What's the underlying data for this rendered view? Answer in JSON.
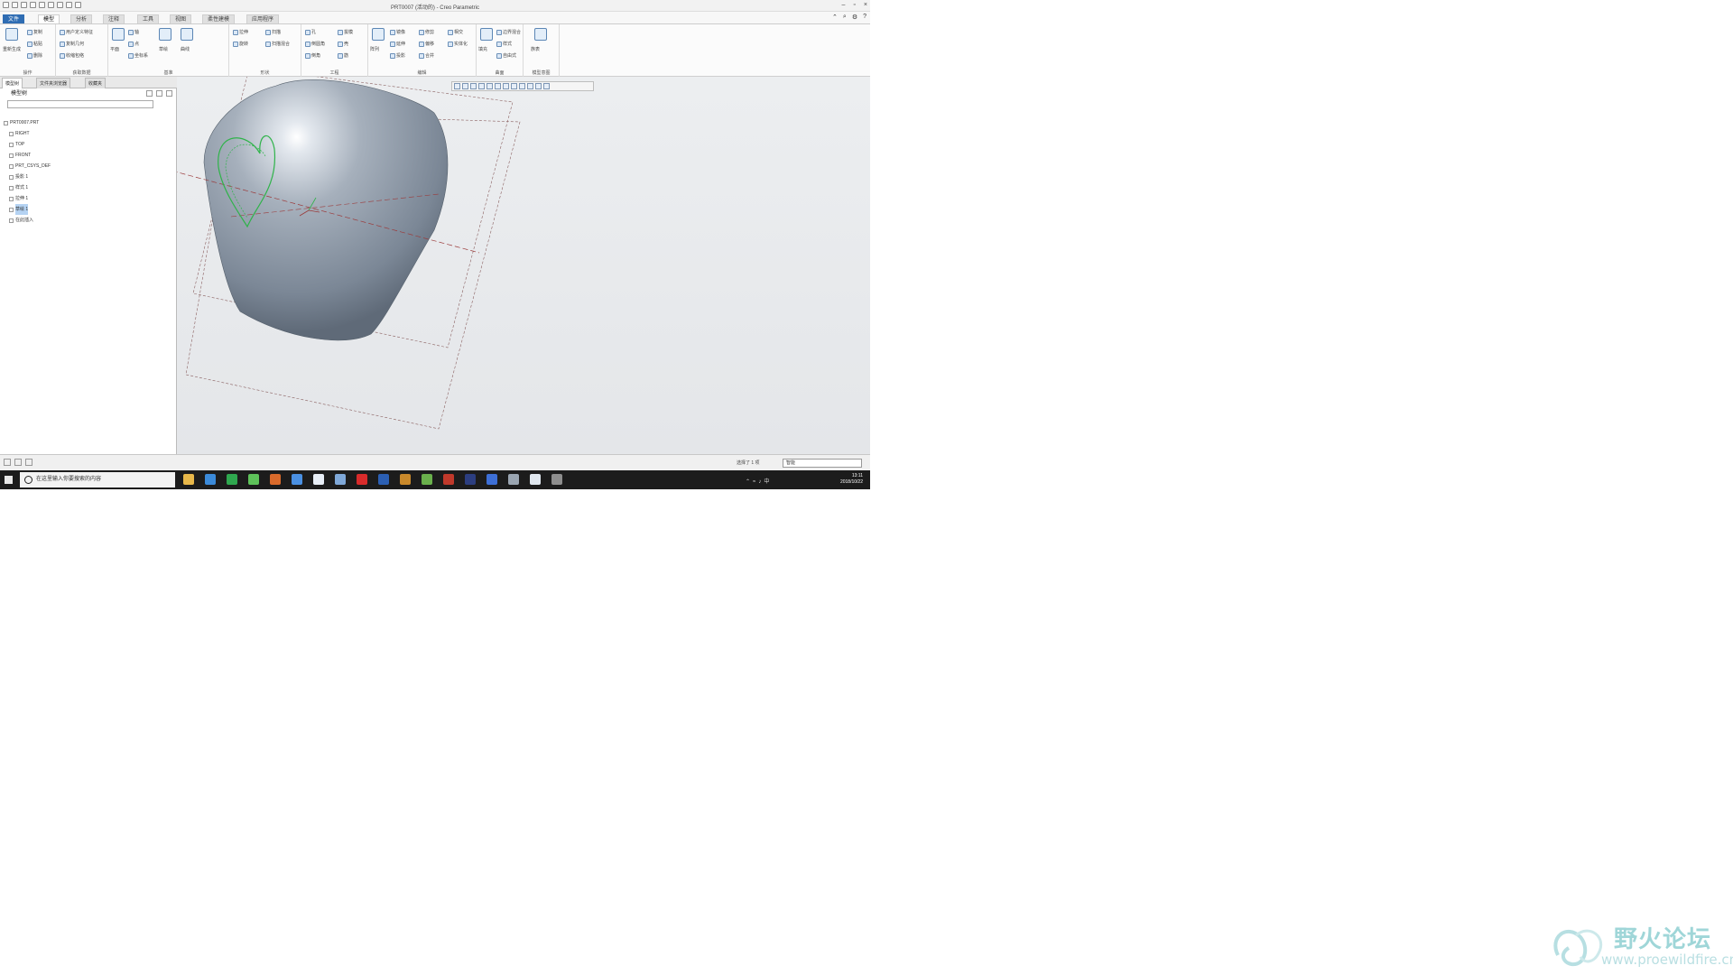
{
  "window": {
    "title": "PRT0007 (活动的) - Creo Parametric"
  },
  "quick_access_icons": [
    "new-icon",
    "open-icon",
    "save-icon",
    "undo-icon",
    "redo-icon",
    "regenerate-icon",
    "windows-icon",
    "close-icon",
    "customize-icon"
  ],
  "window_controls": [
    "–",
    "▫",
    "×"
  ],
  "tabs": [
    "文件",
    "模型",
    "分析",
    "注释",
    "工具",
    "视图",
    "柔性建模",
    "应用程序"
  ],
  "active_tab": "模型",
  "ribbon": {
    "groups": [
      {
        "label": "操作",
        "items": [
          "重新生成",
          "复制",
          "粘贴",
          "删除"
        ]
      },
      {
        "label": "获取数据",
        "items": [
          "用户定义特征",
          "复制几何",
          "收缩包络"
        ]
      },
      {
        "label": "基准",
        "items": [
          "平面",
          "轴",
          "点",
          "坐标系",
          "草绘",
          "曲线"
        ]
      },
      {
        "label": "形状",
        "items": [
          "拉伸",
          "旋转",
          "扫描",
          "扫描混合"
        ]
      },
      {
        "label": "工程",
        "items": [
          "孔",
          "倒圆角",
          "倒角",
          "拔模",
          "壳",
          "筋"
        ]
      },
      {
        "label": "编辑",
        "items": [
          "阵列",
          "镜像",
          "延伸",
          "投影",
          "修剪",
          "偏移",
          "合并",
          "相交",
          "实体化"
        ]
      },
      {
        "label": "曲面",
        "items": [
          "填充",
          "边界混合",
          "样式",
          "自由式"
        ]
      },
      {
        "label": "模型意图",
        "items": [
          "族表"
        ]
      }
    ]
  },
  "left_panel": {
    "tabs": [
      "模型树",
      "文件夹浏览器",
      "收藏夹"
    ],
    "header": "模型树",
    "search_placeholder": "",
    "tree": [
      {
        "label": "PRT0007.PRT",
        "indent": 0,
        "selected": false
      },
      {
        "label": "RIGHT",
        "indent": 1,
        "selected": false
      },
      {
        "label": "TOP",
        "indent": 1,
        "selected": false
      },
      {
        "label": "FRONT",
        "indent": 1,
        "selected": false
      },
      {
        "label": "PRT_CSYS_DEF",
        "indent": 1,
        "selected": false
      },
      {
        "label": "投影 1",
        "indent": 1,
        "selected": false
      },
      {
        "label": "样式 1",
        "indent": 1,
        "selected": false
      },
      {
        "label": "拉伸 1",
        "indent": 1,
        "selected": false
      },
      {
        "label": "草绘 1",
        "indent": 1,
        "selected": true
      },
      {
        "label": "在此插入",
        "indent": 1,
        "selected": false
      }
    ]
  },
  "view_toolbar_icons": [
    "refit-icon",
    "zoom-in-icon",
    "zoom-out-icon",
    "repaint-icon",
    "display-style-icon",
    "saved-views-icon",
    "plane-display-icon",
    "axis-display-icon",
    "point-display-icon",
    "csys-display-icon",
    "annotation-display-icon",
    "spin-center-icon"
  ],
  "colors": {
    "accent": "#2f6db3",
    "model": "#8e9aa8",
    "sketch": "#2fb34a",
    "datum": "#9b3b3b"
  },
  "status_bar": {
    "message": "选择了 1 项",
    "filter": "智能"
  },
  "taskbar": {
    "search_placeholder": "在这里输入你要搜索的内容",
    "time": "13:11",
    "date": "2018/10/22",
    "ime": "中"
  },
  "watermark": {
    "text": "野火论坛",
    "url": "www.proewildfire.cn"
  }
}
